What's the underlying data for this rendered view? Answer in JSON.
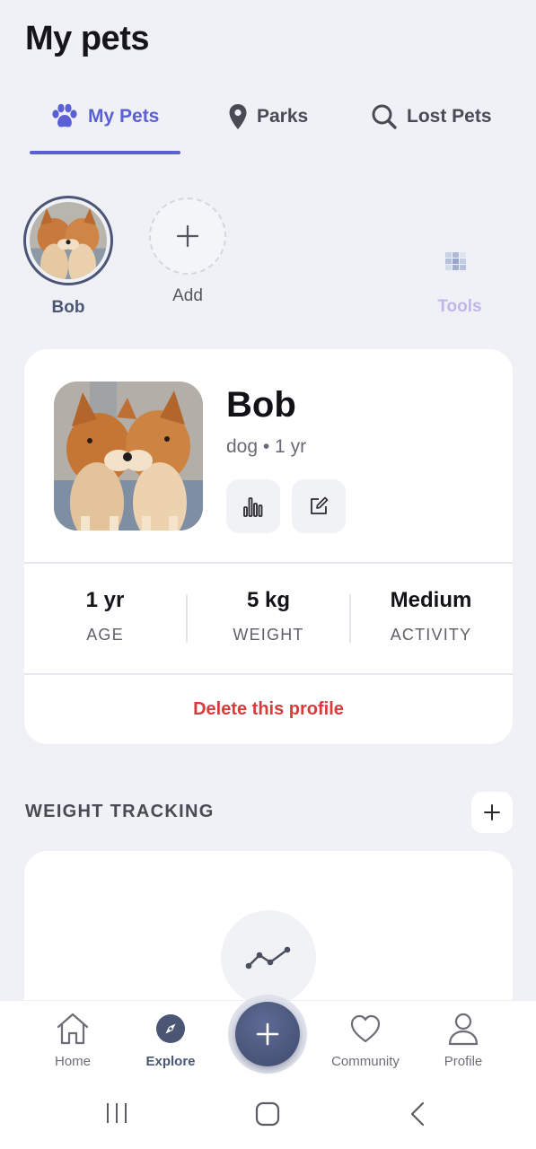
{
  "header": {
    "title": "My pets"
  },
  "tabs": [
    {
      "label": "My Pets",
      "icon": "paw-icon",
      "active": true
    },
    {
      "label": "Parks",
      "icon": "location-pin-icon",
      "active": false
    },
    {
      "label": "Lost Pets",
      "icon": "search-icon",
      "active": false
    }
  ],
  "pet_selector": {
    "pets": [
      {
        "name": "Bob",
        "selected": true
      }
    ],
    "add_label": "Add",
    "tools_label": "Tools"
  },
  "pet_card": {
    "name": "Bob",
    "subtitle": "dog • 1 yr",
    "stats": [
      {
        "value": "1 yr",
        "label": "AGE"
      },
      {
        "value": "5 kg",
        "label": "WEIGHT"
      },
      {
        "value": "Medium",
        "label": "ACTIVITY"
      }
    ],
    "delete_label": "Delete this profile"
  },
  "weight_tracking": {
    "title": "WEIGHT TRACKING"
  },
  "bottom_nav": {
    "items": [
      {
        "label": "Home",
        "icon": "home-icon",
        "active": false
      },
      {
        "label": "Explore",
        "icon": "compass-icon",
        "active": true
      },
      {
        "label": "Community",
        "icon": "heart-icon",
        "active": false
      },
      {
        "label": "Profile",
        "icon": "user-icon",
        "active": false
      }
    ],
    "fab_icon": "plus-icon"
  },
  "colors": {
    "accent": "#5b5fd6",
    "primary_dark": "#4b5675",
    "danger": "#d83b3b",
    "tools_muted": "#c0b6ec",
    "background": "#f0f1f6"
  }
}
